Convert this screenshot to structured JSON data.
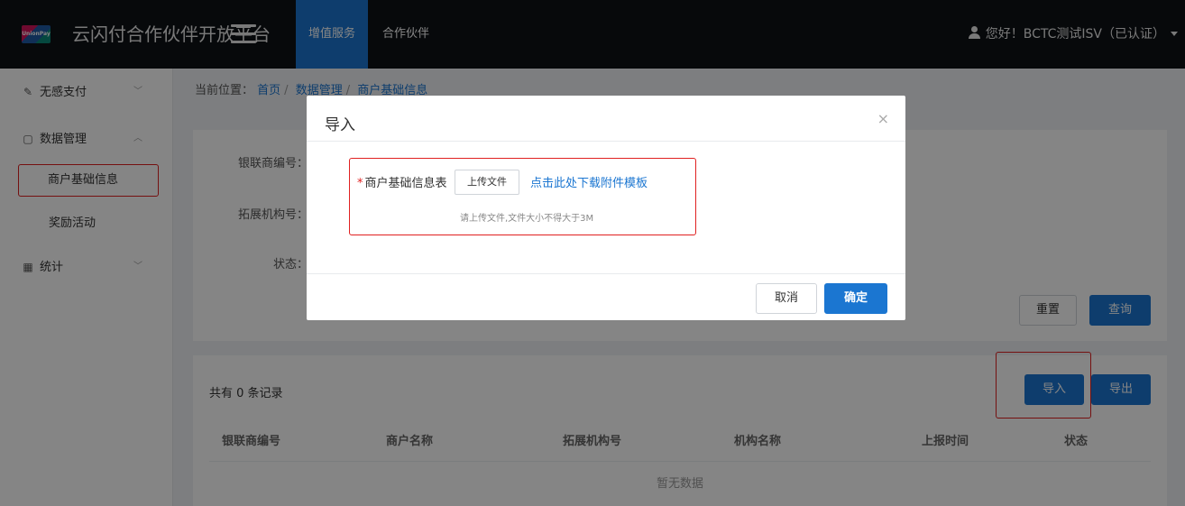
{
  "header": {
    "logo_text": "UnionPay",
    "app_title": "云闪付合作伙伴开放平台",
    "tabs": [
      {
        "label": "增值服务",
        "active": true
      },
      {
        "label": "合作伙伴",
        "active": false
      }
    ],
    "user_greeting": "您好！BCTC测试ISV（已认证）"
  },
  "sidebar": {
    "items": [
      {
        "label": "无感支付",
        "icon": "pen-icon",
        "expanded": false
      },
      {
        "label": "数据管理",
        "icon": "document-icon",
        "expanded": true
      },
      {
        "label": "统计",
        "icon": "calendar-icon",
        "expanded": false
      }
    ],
    "sub_items": [
      {
        "label": "商户基础信息",
        "selected": true
      },
      {
        "label": "奖励活动",
        "selected": false
      }
    ]
  },
  "breadcrumb": {
    "prefix": "当前位置：",
    "items": [
      "首页",
      "数据管理",
      "商户基础信息"
    ]
  },
  "filter_form": {
    "labels": [
      "银联商编号：",
      "拓展机构号：",
      "状态："
    ],
    "reset_label": "重置",
    "query_label": "查询"
  },
  "list": {
    "record_count": "共有 0 条记录",
    "import_label": "导入",
    "export_label": "导出",
    "columns": [
      "银联商编号",
      "商户名称",
      "拓展机构号",
      "机构名称",
      "上报时间",
      "状态"
    ],
    "empty_text": "暂无数据"
  },
  "modal": {
    "title": "导入",
    "close_glyph": "×",
    "field_label": "商户基础信息表",
    "required_mark": "*",
    "upload_label": "上传文件",
    "download_link": "点击此处下载附件模板",
    "hint": "请上传文件,文件大小不得大于3M",
    "cancel_label": "取消",
    "confirm_label": "确定"
  },
  "colors": {
    "primary": "#1b76d1",
    "highlight_box": "#e02020",
    "header_bg": "#0e1216"
  }
}
